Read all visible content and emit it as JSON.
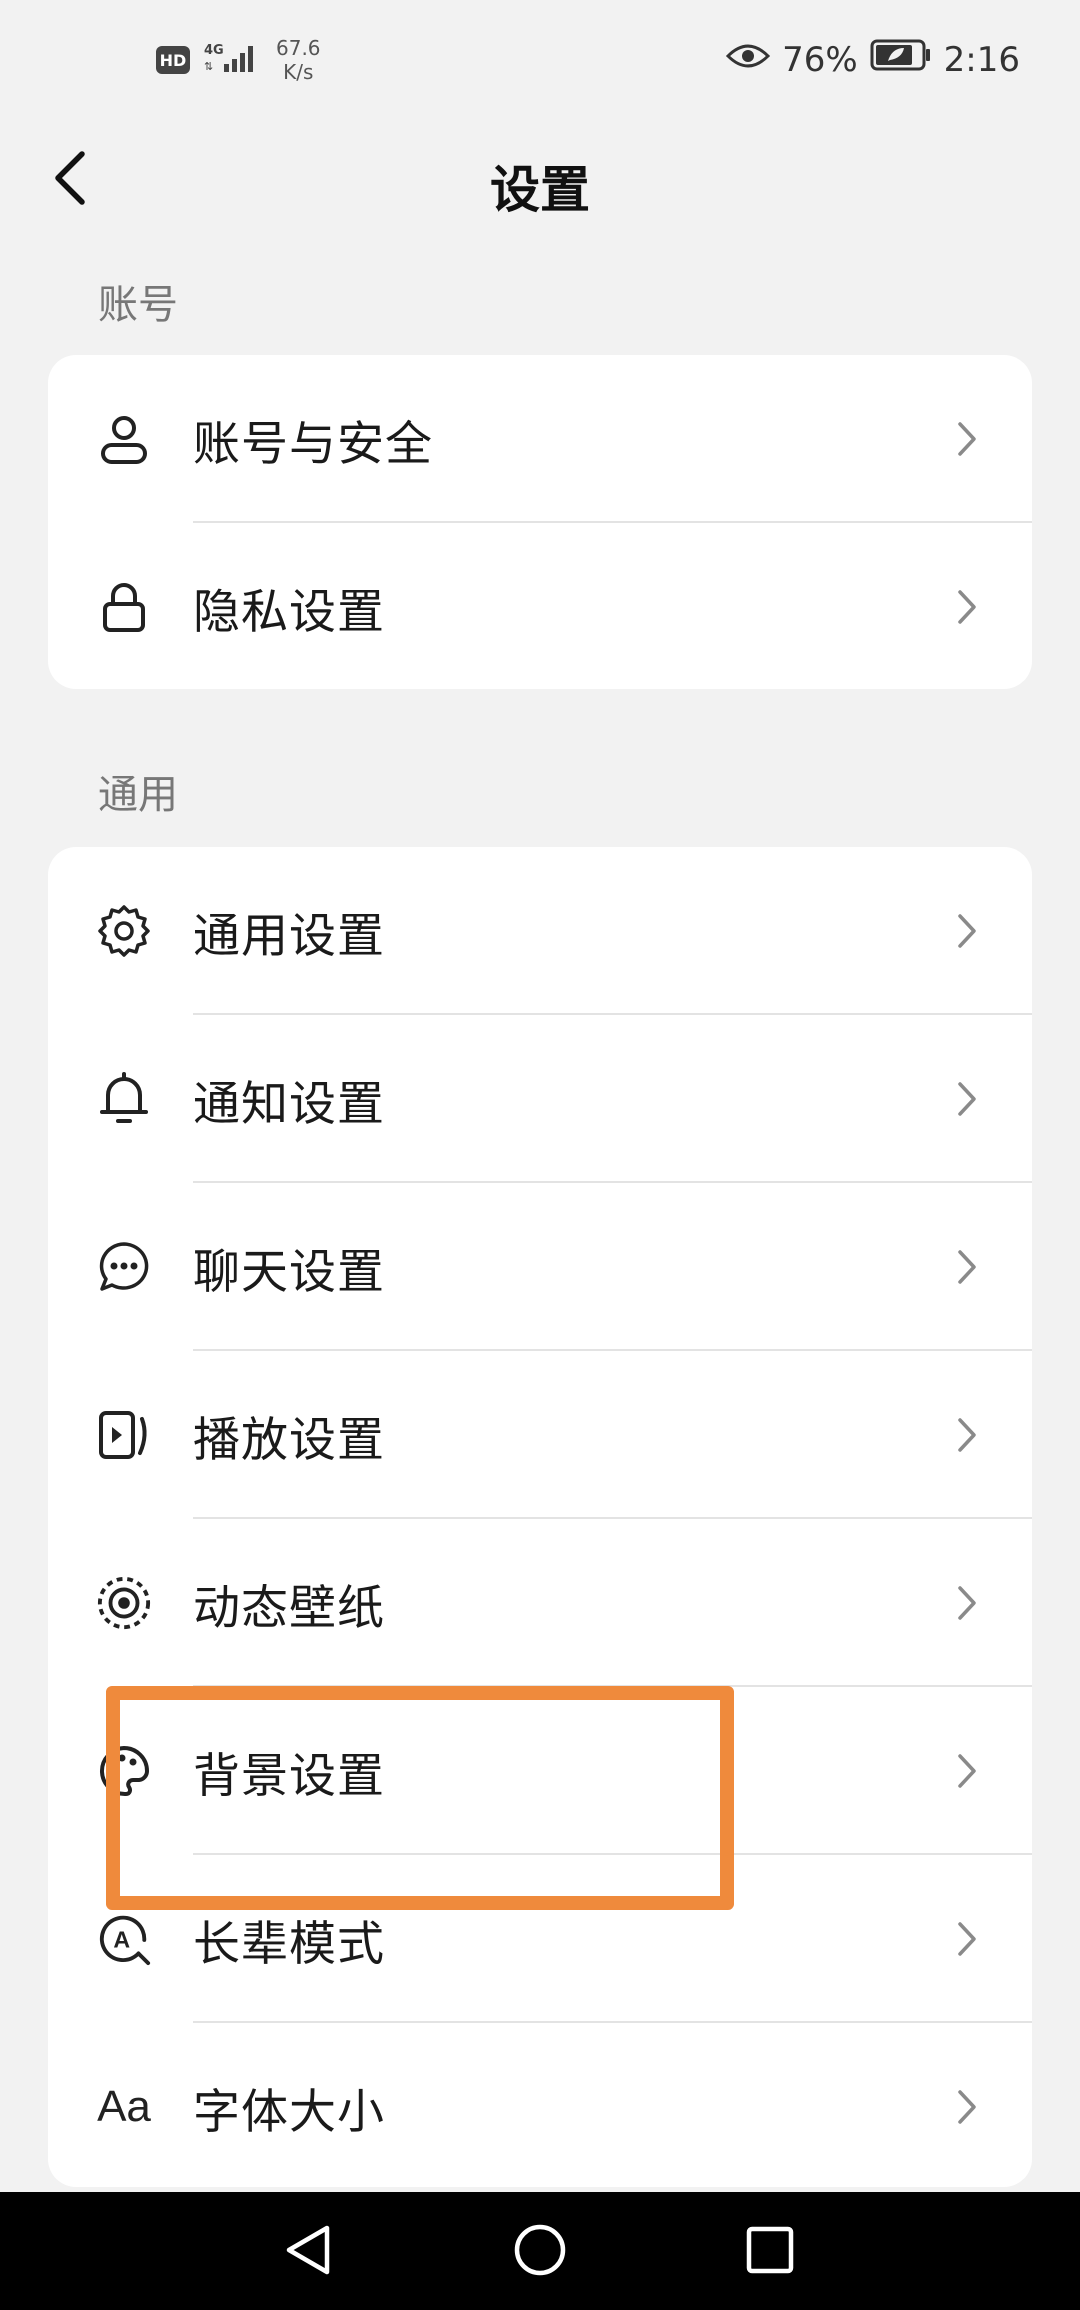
{
  "status_bar": {
    "hd": "HD",
    "net_speed_value": "67.6",
    "net_speed_unit": "K/s",
    "battery_percent": "76%",
    "time": "2:16"
  },
  "header": {
    "title": "设置"
  },
  "sections": {
    "account": {
      "label": "账号",
      "items": [
        {
          "label": "账号与安全",
          "icon": "person-icon"
        },
        {
          "label": "隐私设置",
          "icon": "lock-icon"
        }
      ]
    },
    "general": {
      "label": "通用",
      "items": [
        {
          "label": "通用设置",
          "icon": "gear-icon"
        },
        {
          "label": "通知设置",
          "icon": "bell-icon"
        },
        {
          "label": "聊天设置",
          "icon": "chat-bubble-icon"
        },
        {
          "label": "播放设置",
          "icon": "play-icon"
        },
        {
          "label": "动态壁纸",
          "icon": "live-wallpaper-icon"
        },
        {
          "label": "背景设置",
          "icon": "palette-icon"
        },
        {
          "label": "长辈模式",
          "icon": "elder-mode-icon"
        },
        {
          "label": "字体大小",
          "icon": "font-size-icon",
          "icon_text": "Aa"
        }
      ]
    }
  },
  "colors": {
    "background": "#f2f2f2",
    "card": "#ffffff",
    "highlight": "#ef8a3c",
    "nav_bar": "#000000"
  }
}
